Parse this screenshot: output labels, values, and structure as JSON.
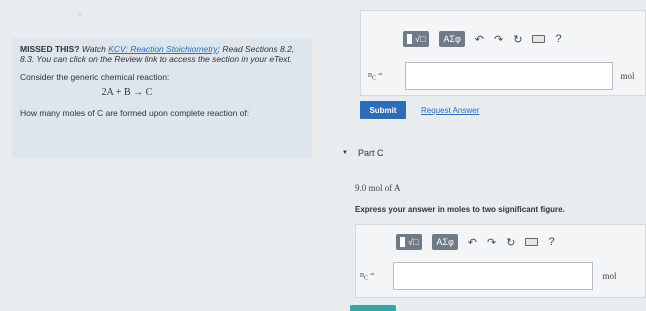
{
  "left": {
    "intro_bold": "MISSED THIS?",
    "intro_watch": " Watch ",
    "intro_link": "KCV: Reaction Stoichiometry",
    "intro_rest": "; Read Sections 8.2, 8.3. You can click on the Review link to access the section in your ",
    "intro_etext": "eText",
    "intro_end": ".",
    "consider": "Consider the generic chemical reaction:",
    "reaction": "2A + B → C",
    "question": "How many moles of C are formed upon complete reaction of:"
  },
  "toolbar_top": {
    "templates_label": "√□",
    "symbols_label": "ΑΣφ",
    "undo_icon": "↶",
    "redo_icon": "↷",
    "reset_icon": "↻",
    "help_label": "?"
  },
  "answer_top": {
    "var": "n",
    "var_sub": "C",
    "eq": " =",
    "value": "",
    "unit": "mol"
  },
  "actions": {
    "submit_label": "Submit",
    "request_label": "Request Answer"
  },
  "part_c": {
    "caret": "▼",
    "label": "Part C",
    "given": "9.0 mol of A",
    "instruction": "Express your answer in moles to two significant figure."
  },
  "toolbar_bottom": {
    "templates_label": "√□",
    "symbols_label": "ΑΣφ",
    "undo_icon": "↶",
    "redo_icon": "↷",
    "reset_icon": "↻",
    "help_label": "?"
  },
  "answer_bottom": {
    "var": "n",
    "var_sub": "C",
    "eq": " =",
    "value": "",
    "unit": "mol"
  },
  "colors": {
    "accent": "#2c6db5",
    "left_panel_bg": "#dde6ec",
    "page_bg": "#e9ecee"
  }
}
